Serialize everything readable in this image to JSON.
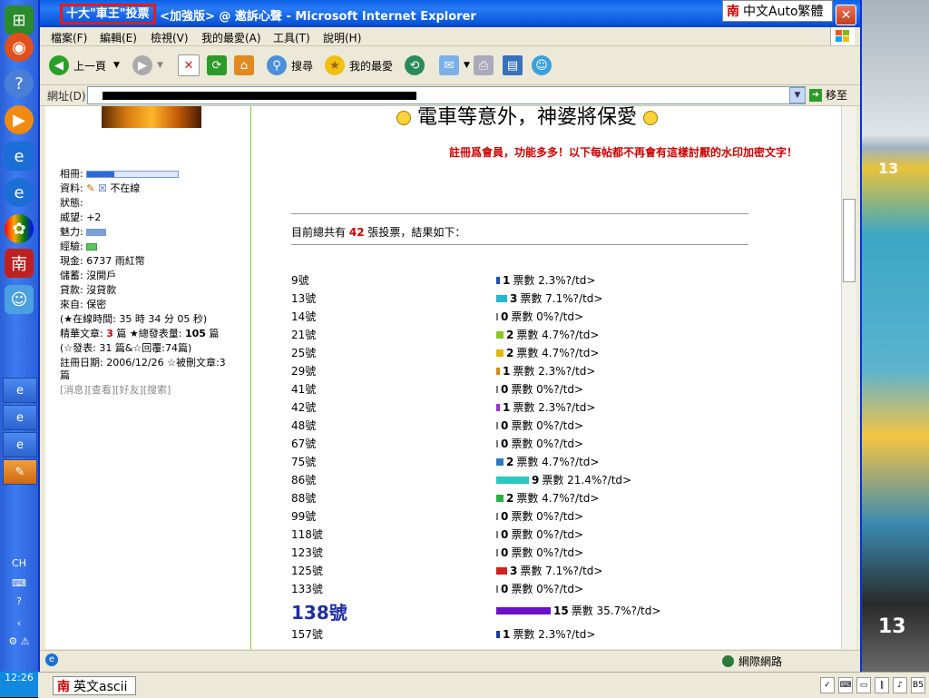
{
  "window": {
    "title_highlight": "十大\"車王\"投票",
    "title_rest": "<加強版> @ 邀訴心聲 - Microsoft Internet Explorer",
    "close_glyph": "✕"
  },
  "ime_top": {
    "label": "中文Auto繁體",
    "mark": "南"
  },
  "menu": [
    "檔案(F)",
    "編輯(E)",
    "檢視(V)",
    "我的最愛(A)",
    "工具(T)",
    "說明(H)"
  ],
  "toolbar": {
    "back": "上一頁",
    "search": "搜尋",
    "favorites": "我的最愛"
  },
  "address": {
    "label": "網址(D)",
    "go": "移至"
  },
  "sidebar": {
    "album": "相冊:",
    "data": "資料:",
    "online_status": "不在線",
    "status": "狀態:",
    "prestige": "威望: +2",
    "charm": "魅力:",
    "exp": "經驗:",
    "cash": "現金: 6737 雨紅幣",
    "savings": "儲蓄: 沒開戶",
    "loan": "貸款: 沒貸款",
    "from": "來自: 保密",
    "online_time": "(★在線時間: 35 時 34 分 05 秒)",
    "essence_a": "精華文章:",
    "essence_n": "3",
    "essence_b": "篇 ★總發表量:",
    "total_posts": "105",
    "essence_c": "篇",
    "posts_line": "(☆發表: 31 篇&☆回覆:74篇)",
    "register": "註冊日期: 2006/12/26 ☆被刪文章:3",
    "register_tail": "篇",
    "links": "[消息][查看][好友][搜索]"
  },
  "content": {
    "heading": "電車等意外，神婆將保愛",
    "notice": "註冊爲會員，功能多多！以下每帖都不再會有這樣討厭的水印加密文字！",
    "total_prefix": "目前總共有",
    "total_count": "42",
    "total_suffix": "張投票，結果如下："
  },
  "votes": [
    {
      "label": "9號",
      "votes": 1,
      "text": "票數 2.3%?/td>",
      "color": "#1f4fb0"
    },
    {
      "label": "13號",
      "votes": 3,
      "text": "票數 7.1%?/td>",
      "color": "#22b8c8"
    },
    {
      "label": "14號",
      "votes": 0,
      "text": "票數 0%?/td>",
      "color": "#777777"
    },
    {
      "label": "21號",
      "votes": 2,
      "text": "票數 4.7%?/td>",
      "color": "#8cc820"
    },
    {
      "label": "25號",
      "votes": 2,
      "text": "票數 4.7%?/td>",
      "color": "#e0b800"
    },
    {
      "label": "29號",
      "votes": 1,
      "text": "票數 2.3%?/td>",
      "color": "#d08a10"
    },
    {
      "label": "41號",
      "votes": 0,
      "text": "票數 0%?/td>",
      "color": "#777777"
    },
    {
      "label": "42號",
      "votes": 1,
      "text": "票數 2.3%?/td>",
      "color": "#9a2fd0"
    },
    {
      "label": "48號",
      "votes": 0,
      "text": "票數 0%?/td>",
      "color": "#777777"
    },
    {
      "label": "67號",
      "votes": 0,
      "text": "票數 0%?/td>",
      "color": "#777777"
    },
    {
      "label": "75號",
      "votes": 2,
      "text": "票數 4.7%?/td>",
      "color": "#2a78c8"
    },
    {
      "label": "86號",
      "votes": 9,
      "text": "票數 21.4%?/td>",
      "color": "#2ac8c0"
    },
    {
      "label": "88號",
      "votes": 2,
      "text": "票數 4.7%?/td>",
      "color": "#2ab040"
    },
    {
      "label": "99號",
      "votes": 0,
      "text": "票數 0%?/td>",
      "color": "#777777"
    },
    {
      "label": "118號",
      "votes": 0,
      "text": "票數 0%?/td>",
      "color": "#777777"
    },
    {
      "label": "123號",
      "votes": 0,
      "text": "票數 0%?/td>",
      "color": "#777777"
    },
    {
      "label": "125號",
      "votes": 3,
      "text": "票數 7.1%?/td>",
      "color": "#d02020"
    },
    {
      "label": "133號",
      "votes": 0,
      "text": "票數 0%?/td>",
      "color": "#777777"
    },
    {
      "label": "138號",
      "votes": 15,
      "text": "票數 35.7%?/td>",
      "color": "#6a10c8",
      "big": true
    },
    {
      "label": "157號",
      "votes": 1,
      "text": "票數 2.3%?/td>",
      "color": "#1a3aa0"
    }
  ],
  "status": {
    "zone": "網際網路"
  },
  "taskbar": {
    "lang": "CH",
    "clock": "12:26",
    "ime": "英文ascii",
    "ime_mark": "南"
  },
  "background": {
    "bus_number_top": "13",
    "bus_number_bottom": "13"
  }
}
